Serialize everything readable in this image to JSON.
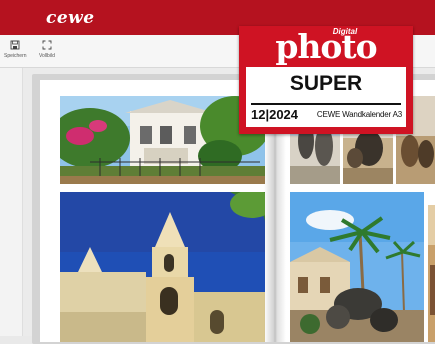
{
  "app": {
    "brand": "cewe"
  },
  "toolbar": {
    "save_label": "Speichern",
    "fullscreen_label": "Vollbild"
  },
  "badge": {
    "magazine_small": "Digital",
    "magazine": "photo",
    "verdict": "SUPER",
    "issue": "12|2024",
    "product": "CEWE Wandkalender A3"
  },
  "colors": {
    "header_red": "#b5121f",
    "badge_red": "#cf1323"
  },
  "icons": [
    "save-icon",
    "fullscreen-icon"
  ]
}
